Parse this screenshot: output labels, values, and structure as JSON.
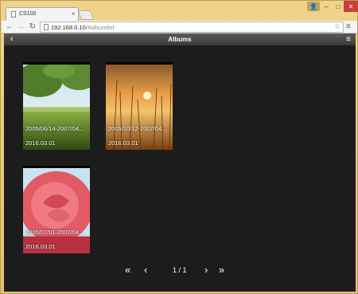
{
  "browser": {
    "tab_title": "CS100",
    "tab_close": "×",
    "url_host": "192.168.0.10",
    "url_path": "/#albumlist",
    "star_icon": "☆",
    "menu_icon": "≡"
  },
  "app": {
    "title": "Albums",
    "back_icon": "‹",
    "menu_icon": "≡"
  },
  "albums": [
    {
      "date_range": "2005/06/14-2007/04...",
      "created": "2016.03.01",
      "thumb": "field-tree"
    },
    {
      "date_range": "2005/10/12-2007/04...",
      "created": "2016.03.01",
      "thumb": "sunset-grass"
    },
    {
      "date_range": "2005/07/01-2007/04...",
      "created": "2016.03.01",
      "thumb": "pink-rose"
    }
  ],
  "pager": {
    "first": "«",
    "prev": "‹",
    "current_page": 1,
    "total_pages": 1,
    "label": "1 / 1",
    "next": "›",
    "last": "»"
  },
  "colors": {
    "app_bg": "#1c1c1c",
    "header": "#4a4a4a",
    "window_frame": "#e6c270",
    "close_button": "#c7403a"
  }
}
